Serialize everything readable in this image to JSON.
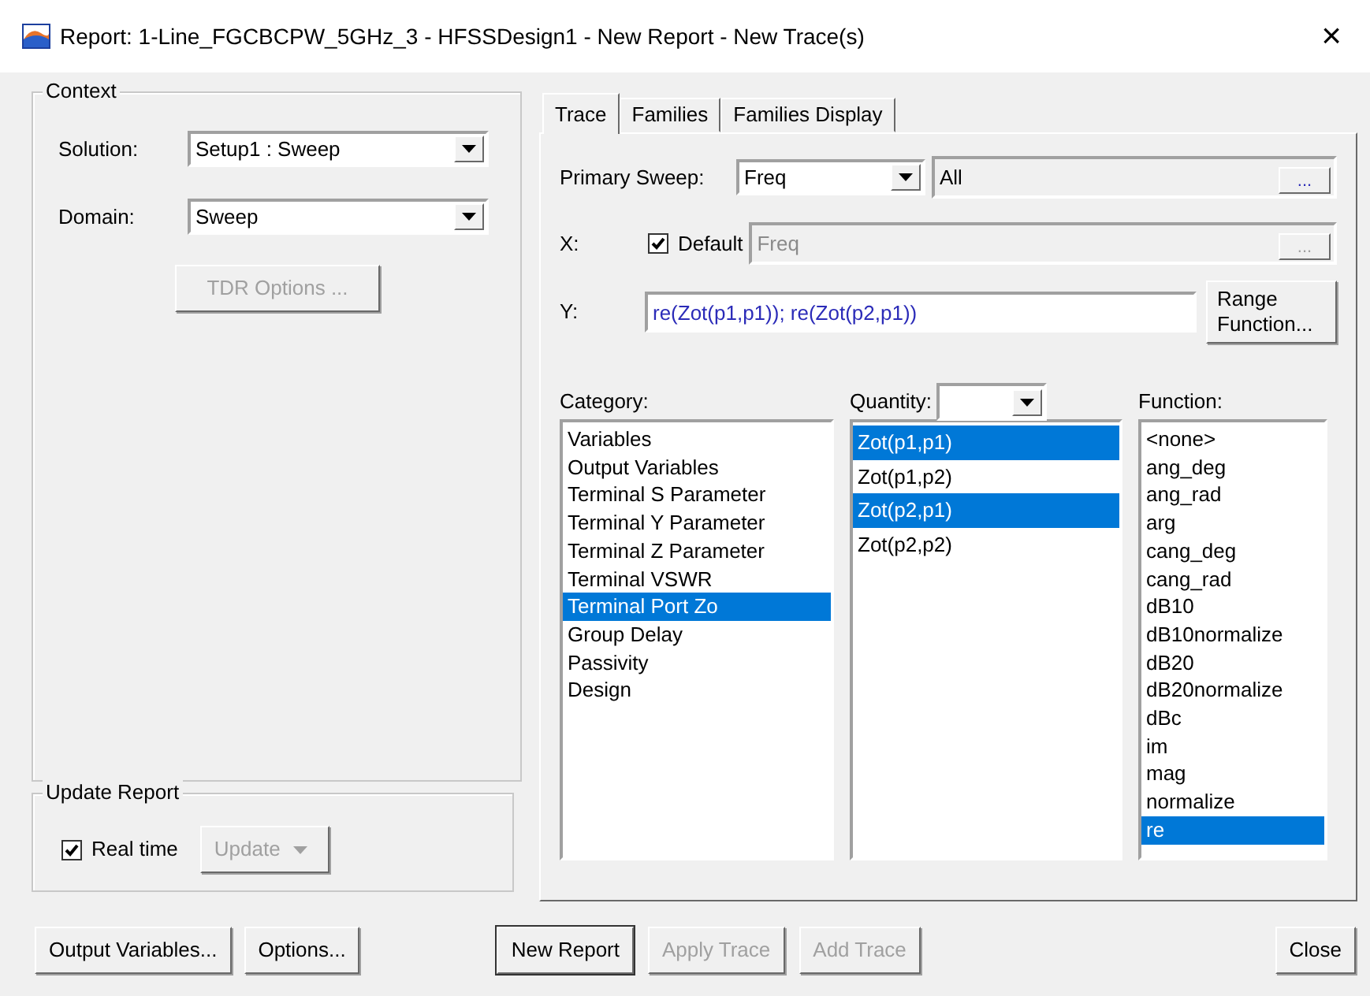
{
  "window": {
    "title": "Report: 1-Line_FGCBCPW_5GHz_3 - HFSSDesign1 - New Report - New Trace(s)",
    "close": "×"
  },
  "context": {
    "legend": "Context",
    "solution": {
      "label": "Solution:",
      "value": "Setup1 : Sweep"
    },
    "domain": {
      "label": "Domain:",
      "value": "Sweep"
    },
    "tdr_button": {
      "label": "TDR Options ...",
      "disabled": true
    }
  },
  "update_report": {
    "legend": "Update Report",
    "real_time": {
      "label": "Real time",
      "checked": true
    },
    "update_button": {
      "label": "Update",
      "disabled": true
    }
  },
  "tabs": [
    {
      "label": "Trace",
      "selected": true
    },
    {
      "label": "Families",
      "selected": false
    },
    {
      "label": "Families Display",
      "selected": false
    }
  ],
  "primary_sweep": {
    "label": "Primary Sweep:",
    "value": "Freq",
    "range": "All",
    "range_button": "..."
  },
  "x": {
    "label": "X:",
    "default": {
      "label": "Default",
      "checked": true
    },
    "value": "Freq",
    "button": "...",
    "disabled": true
  },
  "y": {
    "label": "Y:",
    "value": "re(Zot(p1,p1)); re(Zot(p2,p1))",
    "range_button": "Range Function..."
  },
  "category": {
    "label": "Category:",
    "items": [
      {
        "label": "Variables",
        "selected": false
      },
      {
        "label": "Output Variables",
        "selected": false
      },
      {
        "label": "Terminal S Parameter",
        "selected": false
      },
      {
        "label": "Terminal Y Parameter",
        "selected": false
      },
      {
        "label": "Terminal Z Parameter",
        "selected": false
      },
      {
        "label": "Terminal VSWR",
        "selected": false
      },
      {
        "label": "Terminal Port Zo",
        "selected": true
      },
      {
        "label": "Group Delay",
        "selected": false
      },
      {
        "label": "Passivity",
        "selected": false
      },
      {
        "label": "Design",
        "selected": false
      }
    ]
  },
  "quantity": {
    "label": "Quantity:",
    "items": [
      {
        "label": "Zot(p1,p1)",
        "selected": true
      },
      {
        "label": "Zot(p1,p2)",
        "selected": false
      },
      {
        "label": "Zot(p2,p1)",
        "selected": true
      },
      {
        "label": "Zot(p2,p2)",
        "selected": false
      }
    ]
  },
  "function": {
    "label": "Function:",
    "items": [
      {
        "label": "<none>",
        "selected": false
      },
      {
        "label": "ang_deg",
        "selected": false
      },
      {
        "label": "ang_rad",
        "selected": false
      },
      {
        "label": "arg",
        "selected": false
      },
      {
        "label": "cang_deg",
        "selected": false
      },
      {
        "label": "cang_rad",
        "selected": false
      },
      {
        "label": "dB10",
        "selected": false
      },
      {
        "label": "dB10normalize",
        "selected": false
      },
      {
        "label": "dB20",
        "selected": false
      },
      {
        "label": "dB20normalize",
        "selected": false
      },
      {
        "label": "dBc",
        "selected": false
      },
      {
        "label": "im",
        "selected": false
      },
      {
        "label": "mag",
        "selected": false
      },
      {
        "label": "normalize",
        "selected": false
      },
      {
        "label": "re",
        "selected": true
      }
    ]
  },
  "left_buttons": [
    {
      "label": "Output Variables...",
      "disabled": false
    },
    {
      "label": "Options...",
      "disabled": false
    }
  ],
  "right_buttons": [
    {
      "label": "New Report",
      "disabled": false,
      "default": true
    },
    {
      "label": "Apply Trace",
      "disabled": true,
      "default": false
    },
    {
      "label": "Add Trace",
      "disabled": true,
      "default": false
    },
    {
      "label": "Close",
      "disabled": false,
      "default": false
    }
  ]
}
